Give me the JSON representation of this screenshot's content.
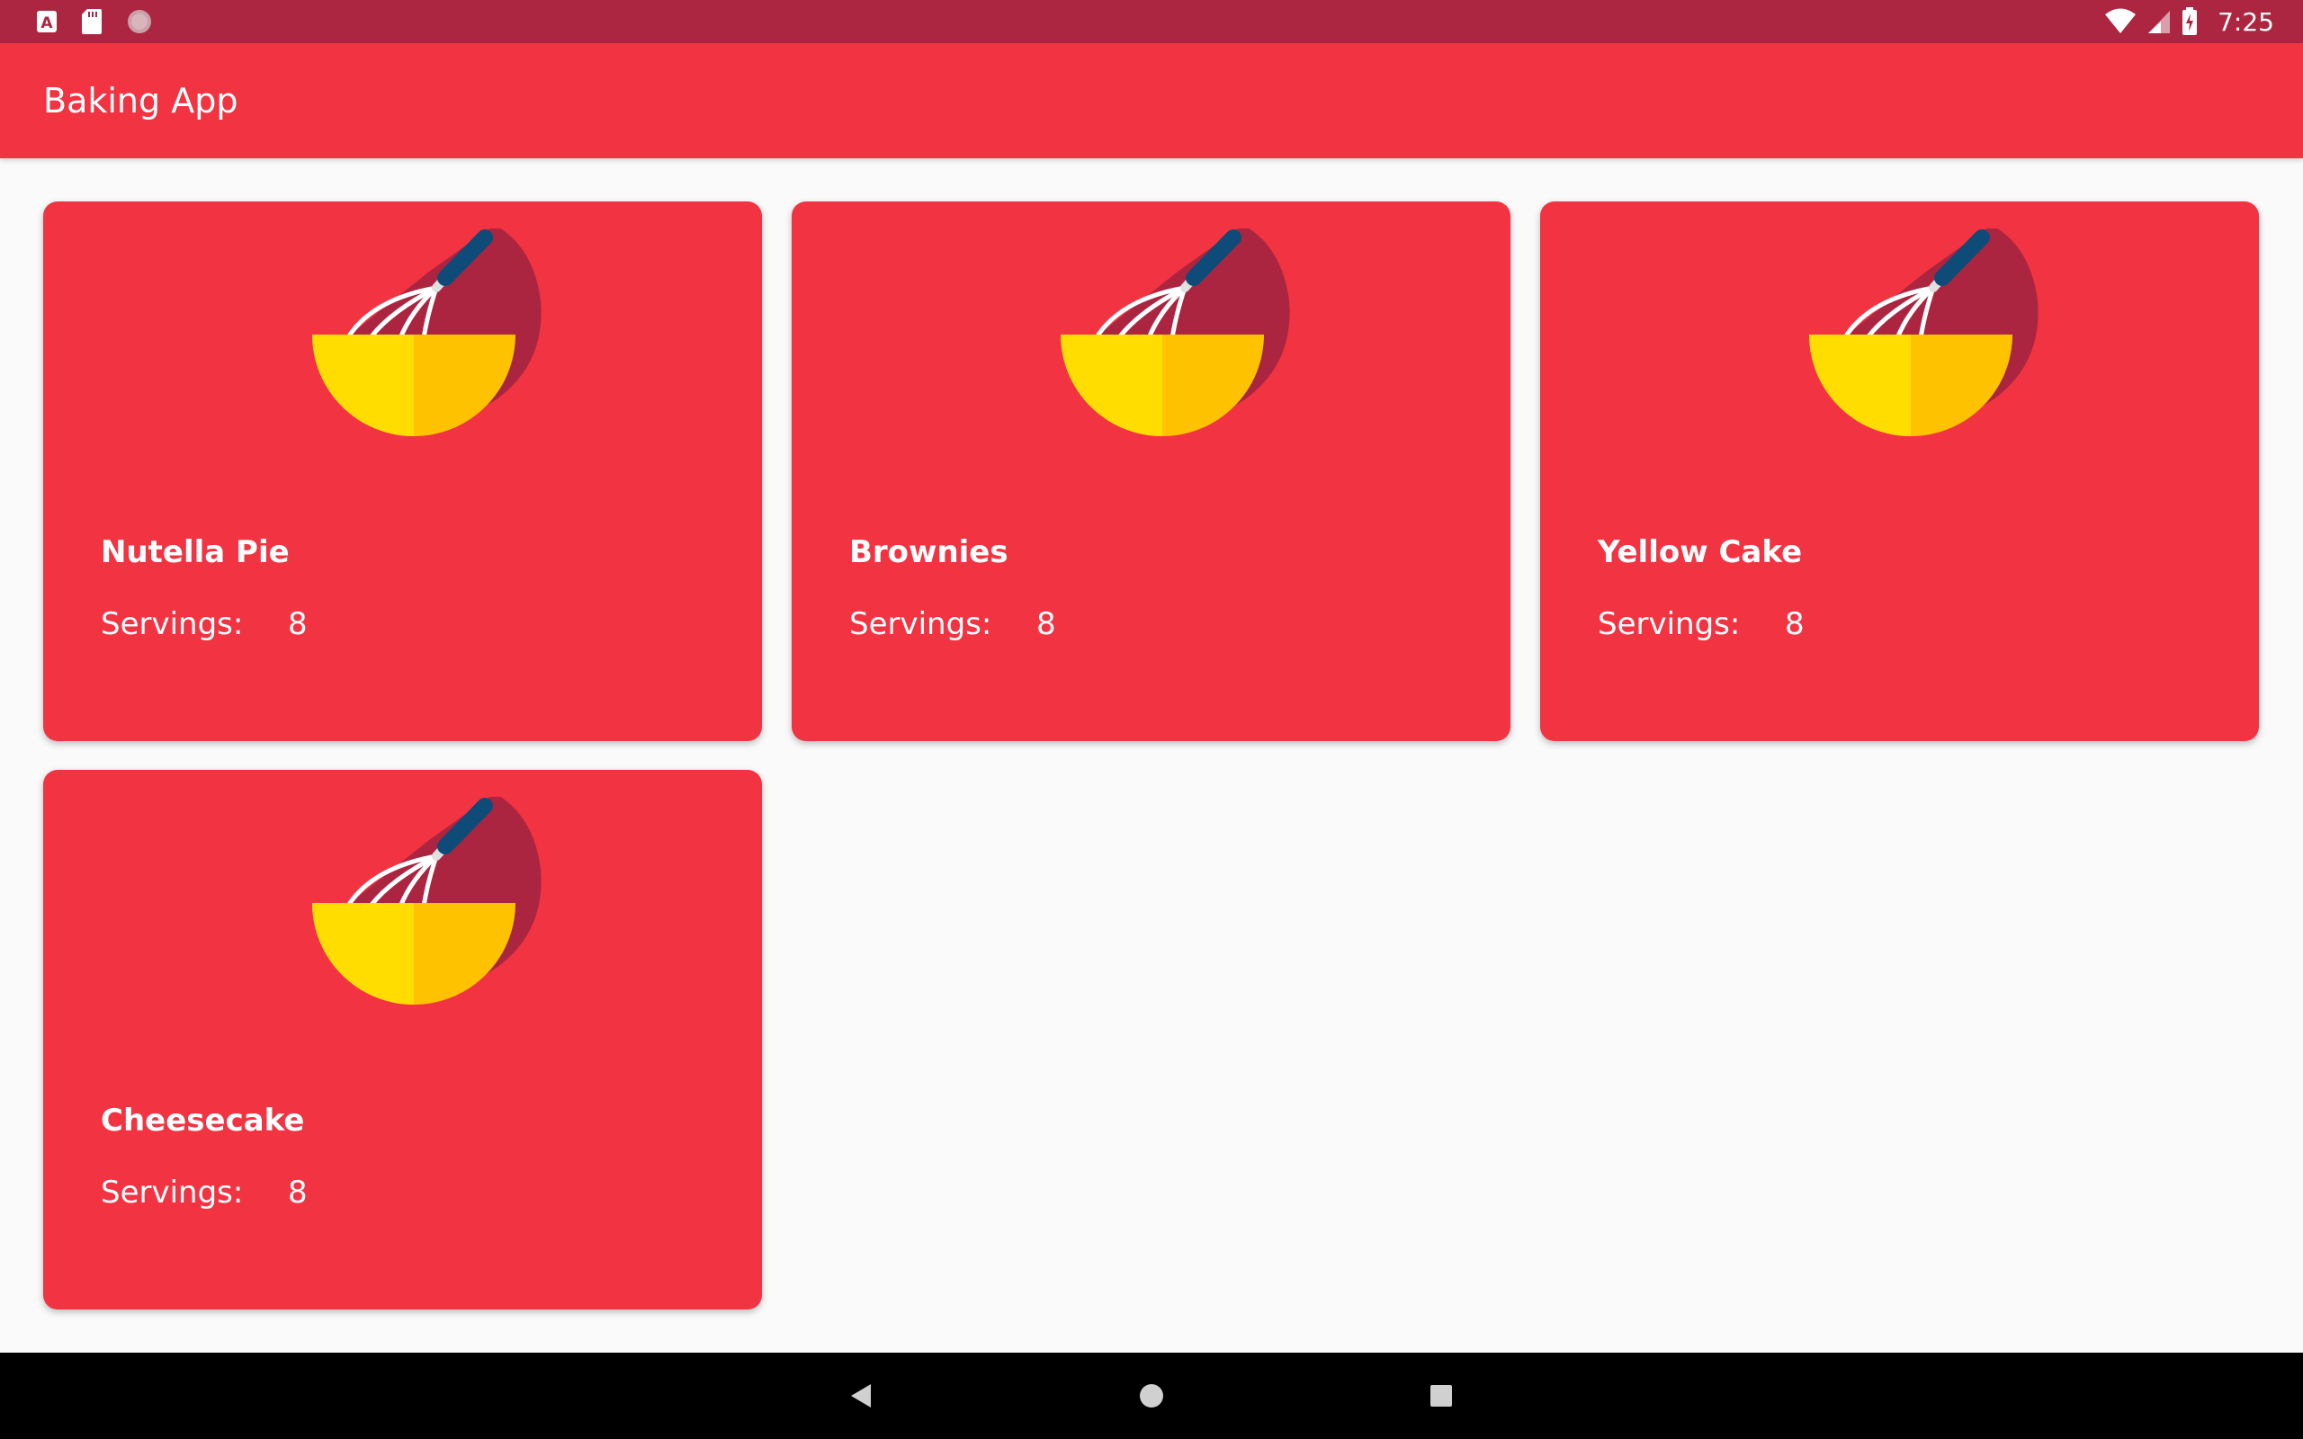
{
  "status_bar": {
    "time": "7:25",
    "left_icons": [
      "a-notification-icon",
      "sd-card-icon",
      "circle-notification-icon"
    ],
    "right_icons": [
      "wifi-icon",
      "cell-signal-icon",
      "battery-charging-icon"
    ]
  },
  "app_bar": {
    "title": "Baking App",
    "color": "#f23342"
  },
  "recipes": [
    {
      "name": "Nutella Pie",
      "servings_label": "Servings:",
      "servings": "8"
    },
    {
      "name": "Brownies",
      "servings_label": "Servings:",
      "servings": "8"
    },
    {
      "name": "Yellow Cake",
      "servings_label": "Servings:",
      "servings": "8"
    },
    {
      "name": "Cheesecake",
      "servings_label": "Servings:",
      "servings": "8"
    }
  ],
  "nav_bar": {
    "buttons": [
      "back-icon",
      "home-icon",
      "recents-icon"
    ]
  },
  "colors": {
    "status_bar": "#ad2641",
    "card": "#f23342",
    "bowl_left": "#ffdd00",
    "bowl_right": "#ffc200"
  }
}
